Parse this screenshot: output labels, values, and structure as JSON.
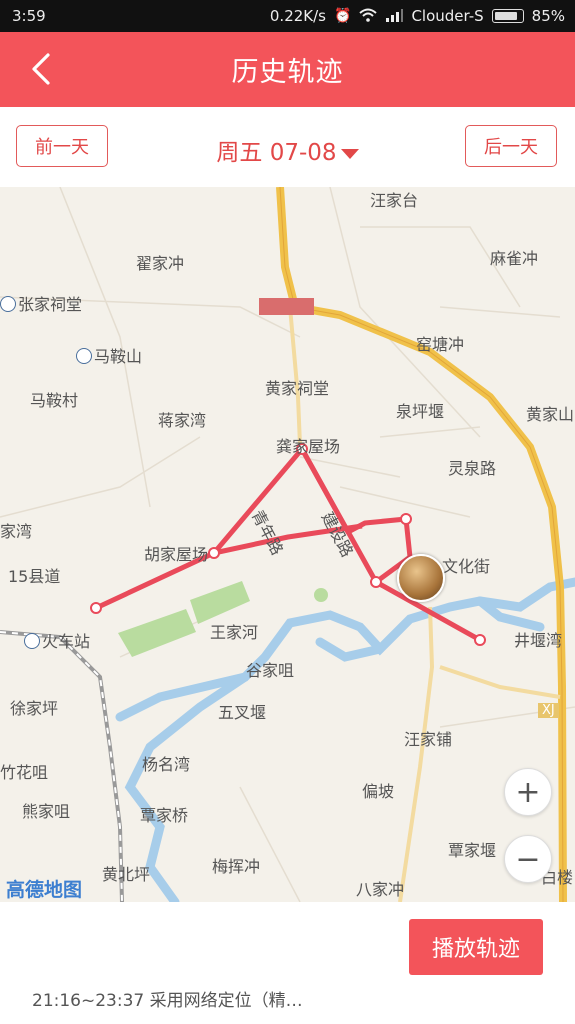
{
  "status_bar": {
    "time": "3:59",
    "network_speed": "0.22K/s",
    "carrier": "Clouder-S",
    "battery_percent": "85%",
    "battery_level": 0.85
  },
  "header": {
    "title": "历史轨迹",
    "back_icon": "back-arrow-icon"
  },
  "date_bar": {
    "prev_label": "前一天",
    "date_label": "周五 07-08",
    "next_label": "后一天",
    "dropdown_icon": "triangle-down-icon"
  },
  "map": {
    "labels": {
      "wangjiatai": "汪家台",
      "majiachong": "麻雀冲",
      "zhaijiachong": "翟家冲",
      "zhangjiacitang": "张家祠堂",
      "maanshan": "马鞍山",
      "yaotangchong": "窑塘冲",
      "huangjiacitang": "黄家祠堂",
      "quanpingyan": "泉坪堰",
      "huangjiashan": "黄家山",
      "maancun": "马鞍村",
      "jiangjiawan": "蒋家湾",
      "gongjiawuchang": "龚家屋场",
      "lingquanlu": "灵泉路",
      "jiawan": "家湾",
      "jiansheliu": "建设路",
      "qingnianlu": "青年路",
      "wenhuajie": "文化街",
      "hujiawuchang": "胡家屋场",
      "xiandao15": "15县道",
      "jingyanwan": "井堰湾",
      "wangjiahe": "王家河",
      "guluzhan": "火车站",
      "gujiaju": "谷家咀",
      "xujiaping": "徐家坪",
      "wuchayan": "五叉堰",
      "xj_road": "XJ",
      "wangjiapu": "汪家铺",
      "zhujiaju": "竹花咀",
      "yangmingwan": "杨名湾",
      "xiongjiaju": "熊家咀",
      "pianpo": "偏坡",
      "qinjiaqiao": "覃家桥",
      "qinjiayan": "覃家堰",
      "huangbeiping": "黄北坪",
      "meihuichong": "梅挥冲",
      "bajiachong": "八家冲",
      "bailou": "白楼"
    },
    "zoom_in_label": "+",
    "zoom_out_label": "−",
    "provider_logo": "高德地图",
    "route_color": "#e94a5a",
    "avatar_icon": "user-avatar-marker"
  },
  "bottom": {
    "play_label": "播放轨迹",
    "info_text": "21:16~23:37 采用网络定位（精…"
  }
}
